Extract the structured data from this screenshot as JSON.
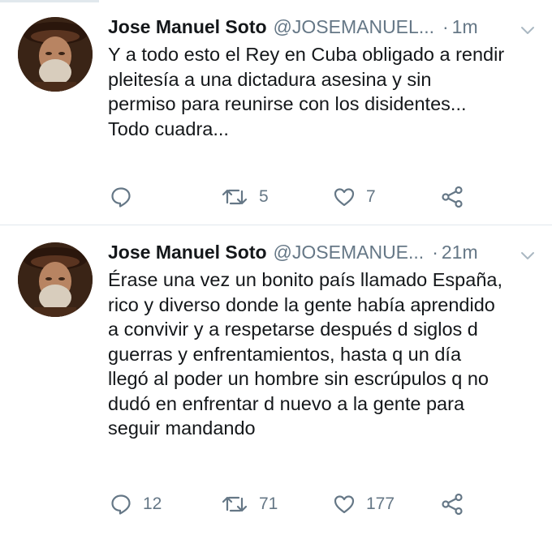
{
  "tweets": [
    {
      "author_name": "Jose Manuel Soto",
      "handle": "@JOSEMANUEL...",
      "separator": "·",
      "time": "1m",
      "text": "Y a todo esto el Rey en Cuba obligado a rendir\npleitesía a una dictadura asesina y sin\npermiso para reunirse con los disidentes...\nTodo cuadra...",
      "replies": "",
      "retweets": "5",
      "likes": "7",
      "avatar_icon": "profile-photo",
      "menu_icon": "chevron-down-icon"
    },
    {
      "author_name": "Jose Manuel Soto",
      "handle": "@JOSEMANUE...",
      "separator": "·",
      "time": "21m",
      "text": "Érase una vez un bonito país llamado España,\nrico y diverso donde la gente había aprendido\na convivir y a respetarse después d siglos d\nguerras y enfrentamientos, hasta q un día\nllegó al poder un hombre sin escrúpulos q no\ndudó en enfrentar d nuevo a la gente para\nseguir mandando",
      "replies": "12",
      "retweets": "71",
      "likes": "177",
      "avatar_icon": "profile-photo",
      "menu_icon": "chevron-down-icon"
    }
  ],
  "colors": {
    "text_primary": "#14171a",
    "text_secondary": "#657786",
    "divider": "#e1e8ed",
    "background": "#ffffff"
  }
}
